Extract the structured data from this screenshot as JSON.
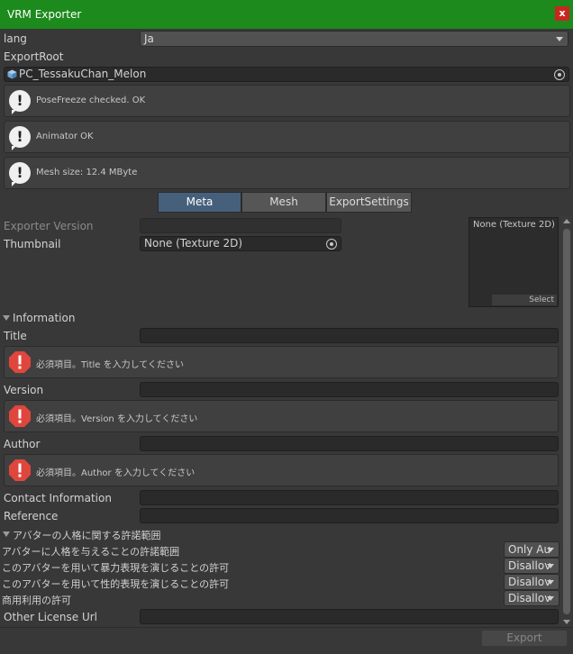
{
  "window": {
    "title": "VRM Exporter",
    "close_glyph": "x"
  },
  "lang": {
    "label": "lang",
    "value": "Ja"
  },
  "export_root": {
    "label": "ExportRoot",
    "value": "PC_TessakuChan_Melon"
  },
  "validation_messages": [
    "PoseFreeze checked. OK",
    "Animator OK",
    "Mesh size: 12.4 MByte"
  ],
  "tabs": [
    {
      "label": "Meta",
      "active": true
    },
    {
      "label": "Mesh",
      "active": false
    },
    {
      "label": "ExportSettings",
      "active": false
    }
  ],
  "meta": {
    "exporter_version_label": "Exporter Version",
    "exporter_version_value": "",
    "thumbnail_label": "Thumbnail",
    "thumbnail_value": "None (Texture 2D)",
    "preview_caption": "None (Texture 2D)",
    "preview_select": "Select"
  },
  "information": {
    "header": "Information",
    "title_label": "Title",
    "title_value": "",
    "title_error": "必須項目。Title を入力してください",
    "version_label": "Version",
    "version_value": "",
    "version_error": "必須項目。Version を入力してください",
    "author_label": "Author",
    "author_value": "",
    "author_error": "必須項目。Author を入力してください",
    "contact_label": "Contact Information",
    "contact_value": "",
    "reference_label": "Reference",
    "reference_value": ""
  },
  "permissions": {
    "header": "アバターの人格に関する許諾範囲",
    "rows": [
      {
        "label": "アバターに人格を与えることの許諾範囲",
        "value": "Only Au"
      },
      {
        "label": "このアバターを用いて暴力表現を演じることの許可",
        "value": "Disallov"
      },
      {
        "label": "このアバターを用いて性的表現を演じることの許可",
        "value": "Disallov"
      },
      {
        "label": "商用利用の許可",
        "value": "Disallov"
      }
    ],
    "other_license_label": "Other License Url",
    "other_license_value": ""
  },
  "footer": {
    "export_label": "Export"
  },
  "colors": {
    "titlebar": "#1c8a1c",
    "close": "#c8271f",
    "tab_active": "#46607c",
    "error_icon": "#e0463c",
    "panel": "#383838"
  }
}
